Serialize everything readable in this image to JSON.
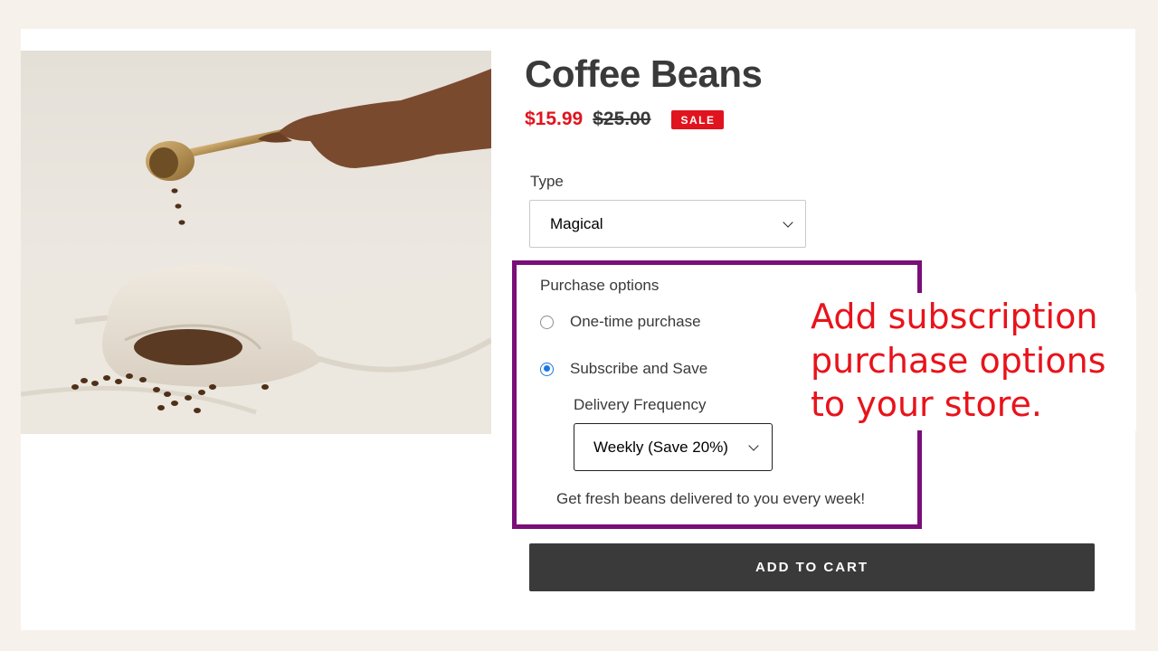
{
  "product": {
    "title": "Coffee Beans",
    "price": "$15.99",
    "compare_price": "$25.00",
    "sale_badge": "SALE"
  },
  "variant": {
    "label": "Type",
    "selected": "Magical"
  },
  "purchase_options": {
    "title": "Purchase options",
    "one_time_label": "One-time purchase",
    "subscribe_label": "Subscribe and Save",
    "selected": "subscribe",
    "frequency_label": "Delivery Frequency",
    "frequency_selected": "Weekly (Save 20%)",
    "description": "Get fresh beans delivered to you every week!"
  },
  "callout": {
    "text": "Add subscription purchase options to your store."
  },
  "cart": {
    "add_label": "ADD TO CART"
  },
  "colors": {
    "sale": "#e0141e",
    "highlight_box": "#7a0f78",
    "radio_selected": "#1b76e0",
    "button_bg": "#3a3a3a",
    "page_bg": "#f6f1ea"
  }
}
